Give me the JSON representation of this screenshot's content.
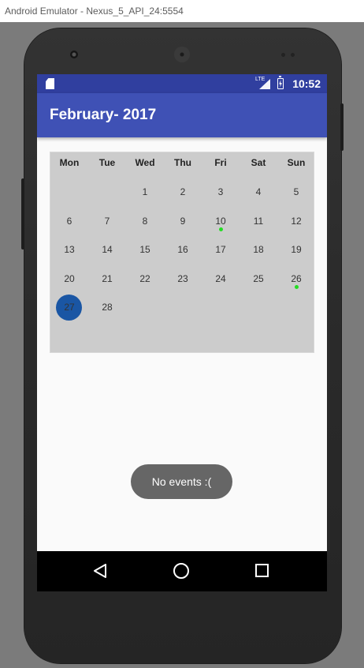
{
  "window": {
    "title": "Android Emulator - Nexus_5_API_24:5554"
  },
  "statusbar": {
    "time": "10:52",
    "network_label": "LTE",
    "icons": [
      "sd-card-icon",
      "signal-icon",
      "battery-charging-icon"
    ]
  },
  "appbar": {
    "title": "February- 2017",
    "color": "#3f51b5"
  },
  "calendar": {
    "weekdays": [
      "Mon",
      "Tue",
      "Wed",
      "Thu",
      "Fri",
      "Sat",
      "Sun"
    ],
    "weeks": [
      [
        "",
        "",
        "1",
        "2",
        "3",
        "4",
        "5"
      ],
      [
        "6",
        "7",
        "8",
        "9",
        "10",
        "11",
        "12"
      ],
      [
        "13",
        "14",
        "15",
        "16",
        "17",
        "18",
        "19"
      ],
      [
        "20",
        "21",
        "22",
        "23",
        "24",
        "25",
        "26"
      ],
      [
        "27",
        "28",
        "",
        "",
        "",
        "",
        ""
      ]
    ],
    "selected_day": "27",
    "event_days": [
      "10",
      "26"
    ],
    "selected_color": "#1a56a4",
    "event_dot_color": "#22dd22"
  },
  "toast": {
    "text": "No events :("
  },
  "navbar": {
    "icons": [
      "back-icon",
      "home-icon",
      "recent-apps-icon"
    ]
  }
}
